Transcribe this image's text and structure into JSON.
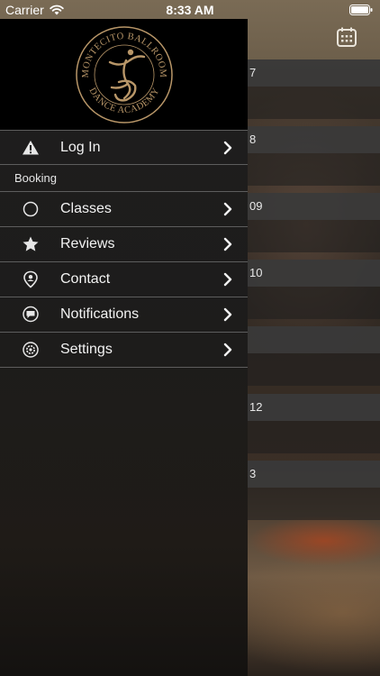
{
  "status_bar": {
    "carrier": "Carrier",
    "time": "8:33 AM"
  },
  "background": {
    "day_labels": [
      "7",
      "8",
      "09",
      "10",
      "",
      "12",
      "3"
    ]
  },
  "drawer": {
    "logo_text_top": "MONTECITO BALLROOM",
    "logo_text_bottom": "DANCE ACADEMY",
    "login": {
      "label": "Log In",
      "icon": "warning-icon"
    },
    "section_header": "Booking",
    "items": [
      {
        "label": "Classes",
        "icon": "circle-icon"
      },
      {
        "label": "Reviews",
        "icon": "star-icon"
      },
      {
        "label": "Contact",
        "icon": "location-pin-icon"
      },
      {
        "label": "Notifications",
        "icon": "chat-bubble-icon"
      },
      {
        "label": "Settings",
        "icon": "gear-icon"
      }
    ]
  },
  "colors": {
    "header_brown": "#6d5f4b",
    "drawer_bg": "#1e1e1e",
    "separator": "#5d5d5d",
    "logo_gold": "#b89668"
  }
}
